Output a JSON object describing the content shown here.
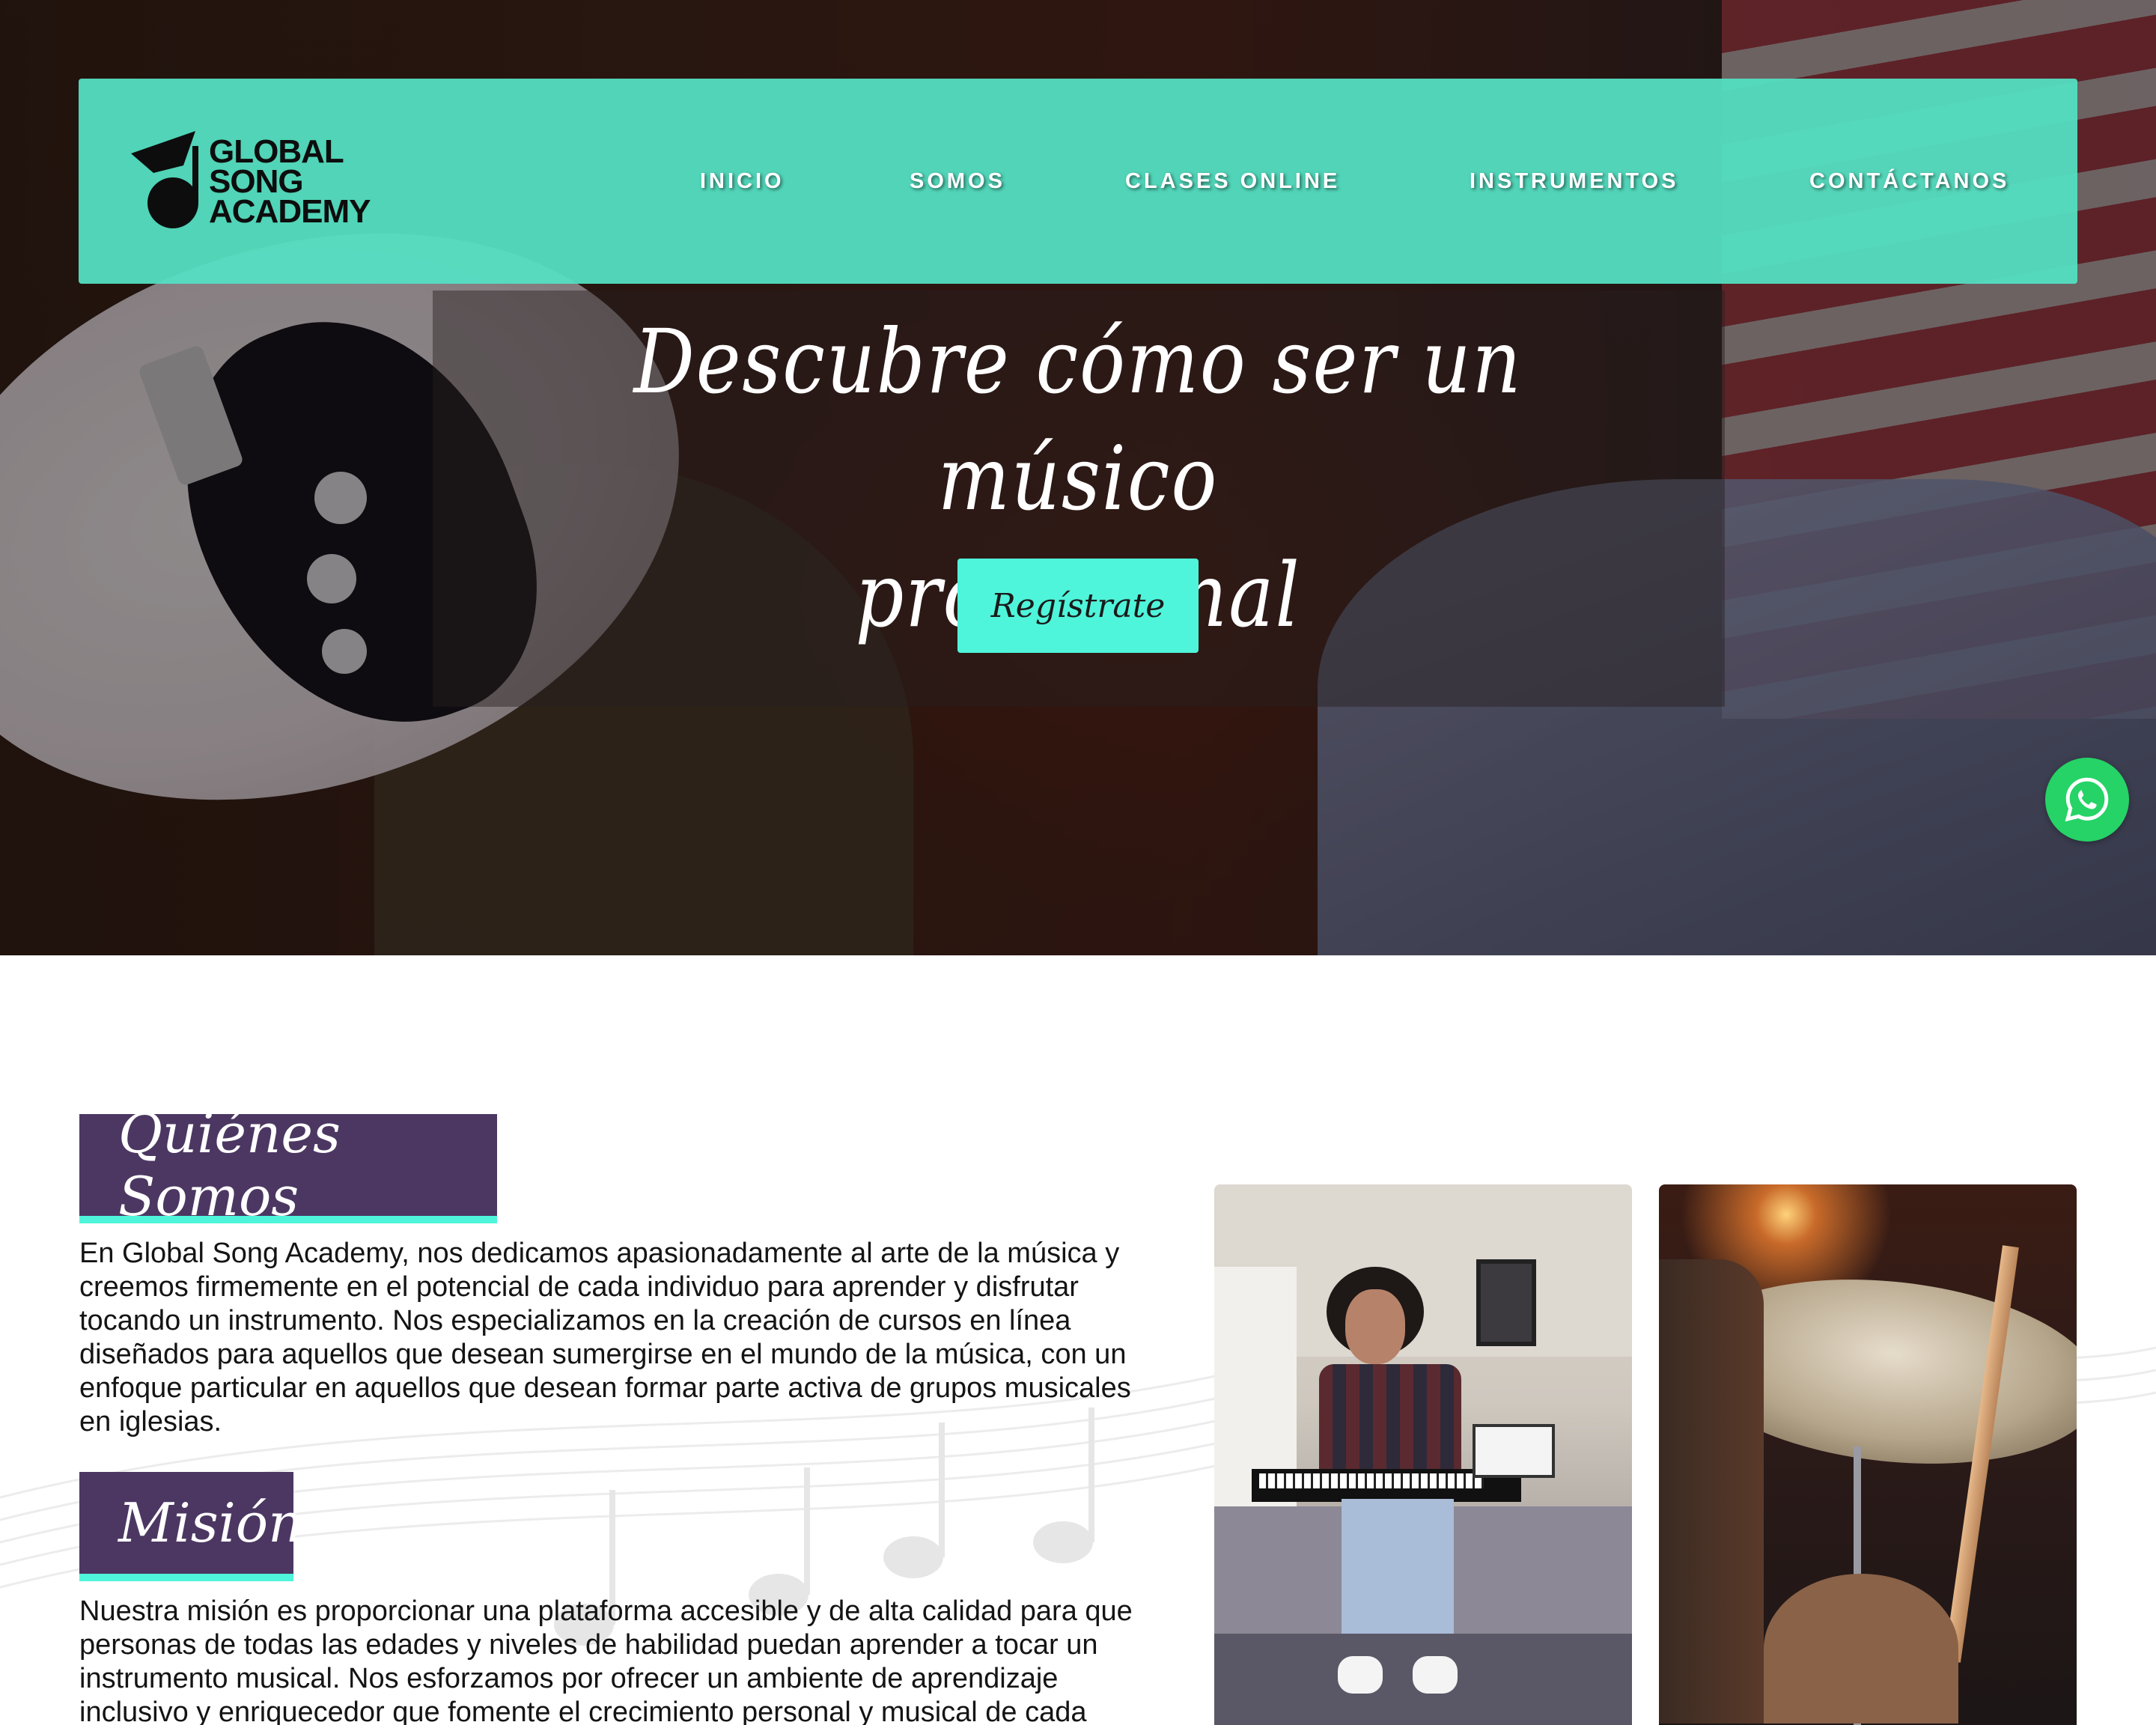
{
  "brand": {
    "logo_line1": "GLOBAL",
    "logo_line2": "SONG",
    "logo_line3": "ACADEMY"
  },
  "nav": {
    "items": [
      {
        "label": "INICIO"
      },
      {
        "label": "SOMOS"
      },
      {
        "label": "CLASES ONLINE"
      },
      {
        "label": "INSTRUMENTOS"
      },
      {
        "label": "CONTÁCTANOS"
      }
    ]
  },
  "hero": {
    "title_line1": "Descubre cómo ser un músico",
    "title_line2": "profesional",
    "cta_label": "Regístrate"
  },
  "about": {
    "heading": "Quiénes Somos",
    "text": "En Global Song Academy, nos dedicamos apasionadamente al arte de la música y creemos firmemente en el potencial de cada individuo para aprender y disfrutar tocando un instrumento. Nos especializamos en la creación de cursos en línea diseñados para aquellos que desean sumergirse en el mundo de la música, con un enfoque particular en aquellos que desean formar parte activa de grupos musicales en iglesias."
  },
  "mission": {
    "heading": "Misión",
    "text": "Nuestra misión es proporcionar una plataforma accesible y de alta calidad para que personas de todas las edades y niveles de habilidad puedan aprender a tocar un instrumento musical. Nos esforzamos por ofrecer un ambiente de aprendizaje inclusivo y enriquecedor que fomente el crecimiento personal y musical de cada"
  },
  "icons": {
    "whatsapp": "whatsapp-icon",
    "logo": "music-note-logo-icon"
  },
  "colors": {
    "nav_bg": "#54e0c2",
    "cta_bg": "#4ff5da",
    "tag_bg": "#4c3762",
    "tag_underline": "#4ff5da",
    "whatsapp": "#25d366"
  }
}
